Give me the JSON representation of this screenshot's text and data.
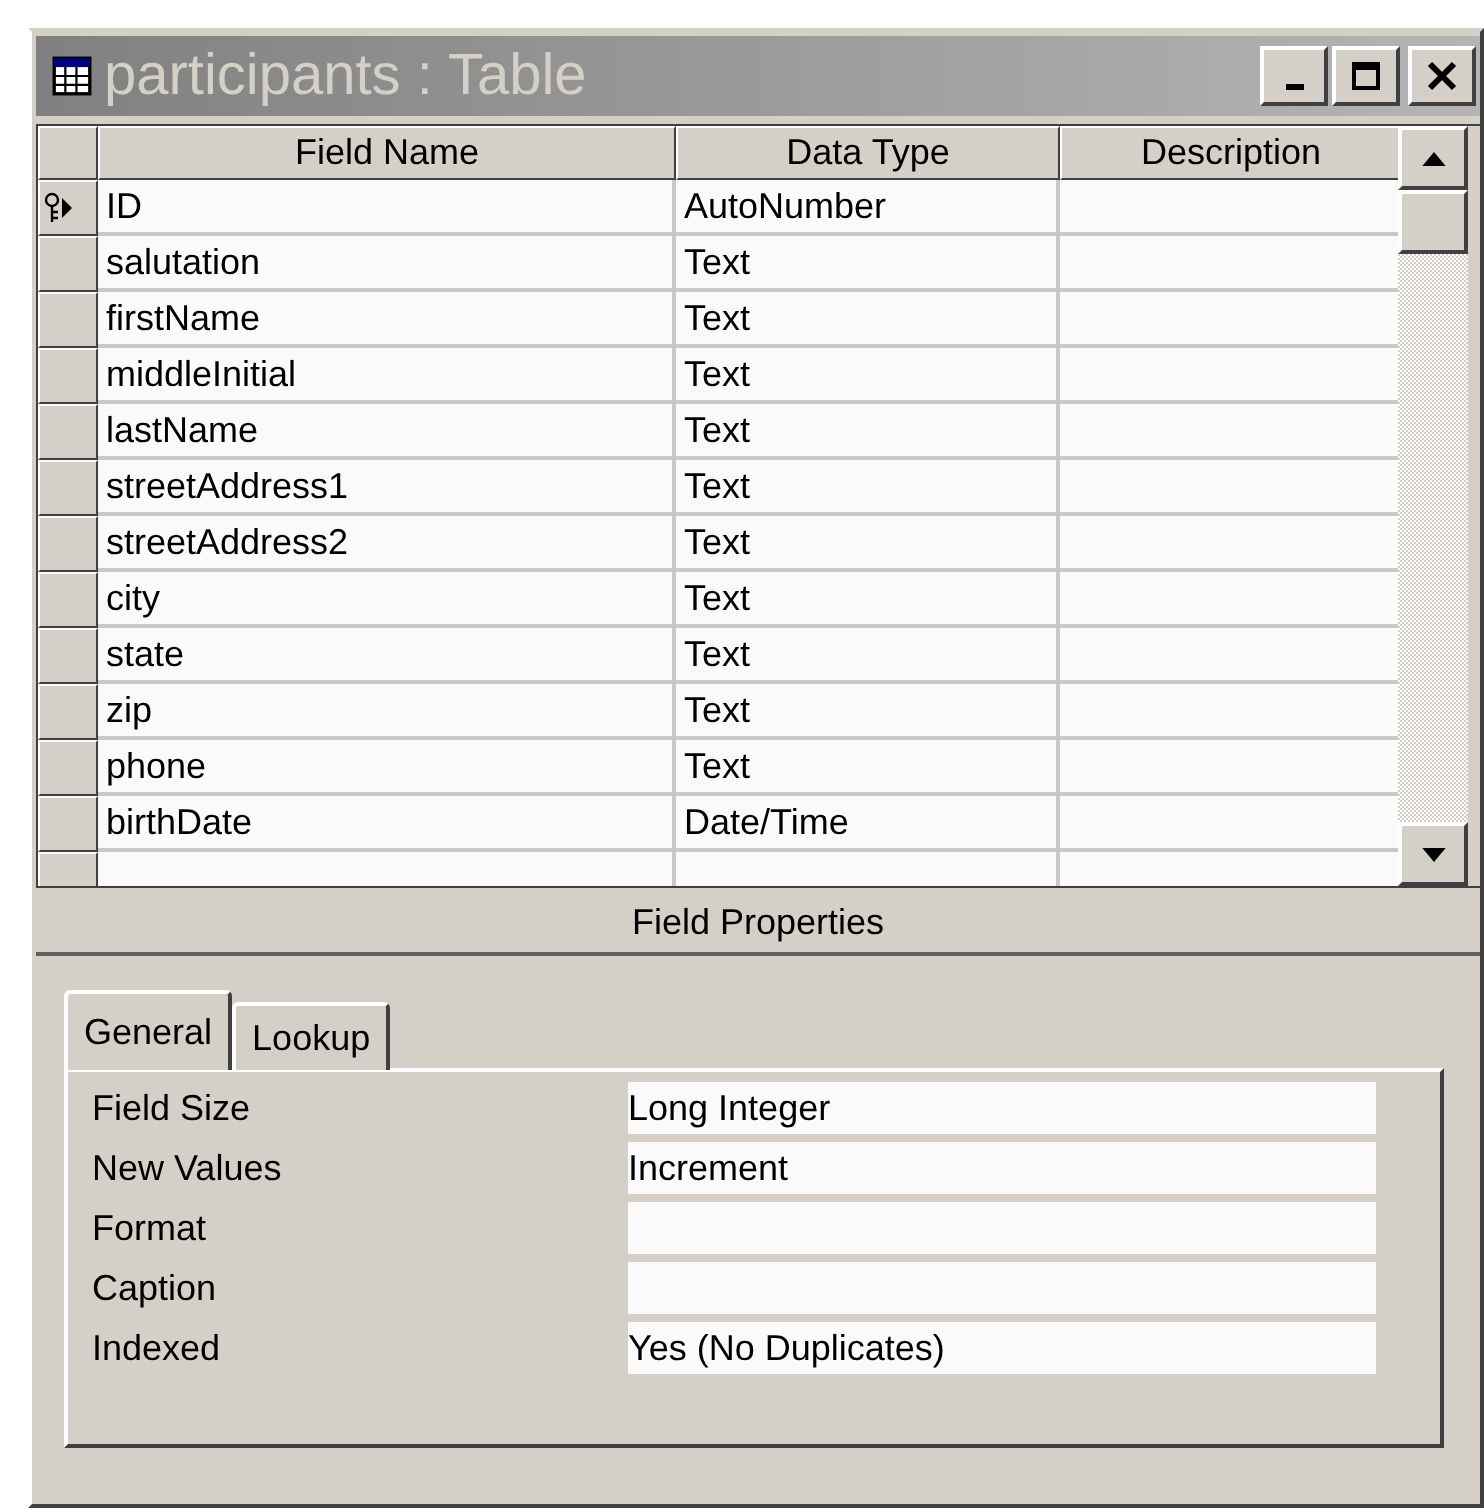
{
  "window": {
    "title": "participants : Table",
    "active": false
  },
  "table": {
    "columns": [
      "Field Name",
      "Data Type",
      "Description"
    ],
    "rows": [
      {
        "field_name": "ID",
        "data_type": "AutoNumber",
        "primary_key": true,
        "selected": true
      },
      {
        "field_name": "salutation",
        "data_type": "Text",
        "primary_key": false,
        "selected": false
      },
      {
        "field_name": "firstName",
        "data_type": "Text",
        "primary_key": false,
        "selected": false
      },
      {
        "field_name": "middleInitial",
        "data_type": "Text",
        "primary_key": false,
        "selected": false
      },
      {
        "field_name": "lastName",
        "data_type": "Text",
        "primary_key": false,
        "selected": false
      },
      {
        "field_name": "streetAddress1",
        "data_type": "Text",
        "primary_key": false,
        "selected": false
      },
      {
        "field_name": "streetAddress2",
        "data_type": "Text",
        "primary_key": false,
        "selected": false
      },
      {
        "field_name": "city",
        "data_type": "Text",
        "primary_key": false,
        "selected": false
      },
      {
        "field_name": "state",
        "data_type": "Text",
        "primary_key": false,
        "selected": false
      },
      {
        "field_name": "zip",
        "data_type": "Text",
        "primary_key": false,
        "selected": false
      },
      {
        "field_name": "phone",
        "data_type": "Text",
        "primary_key": false,
        "selected": false
      },
      {
        "field_name": "birthDate",
        "data_type": "Date/Time",
        "primary_key": false,
        "selected": false
      }
    ]
  },
  "field_properties": {
    "title": "Field Properties",
    "tabs": [
      {
        "label": "General",
        "selected": true
      },
      {
        "label": "Lookup",
        "selected": false
      }
    ],
    "properties": [
      {
        "label": "Field Size",
        "value": "Long Integer"
      },
      {
        "label": "New Values",
        "value": "Increment"
      },
      {
        "label": "Format"
      },
      {
        "label": "Caption"
      },
      {
        "label": "Indexed",
        "value": "Yes (No Duplicates)"
      }
    ]
  }
}
